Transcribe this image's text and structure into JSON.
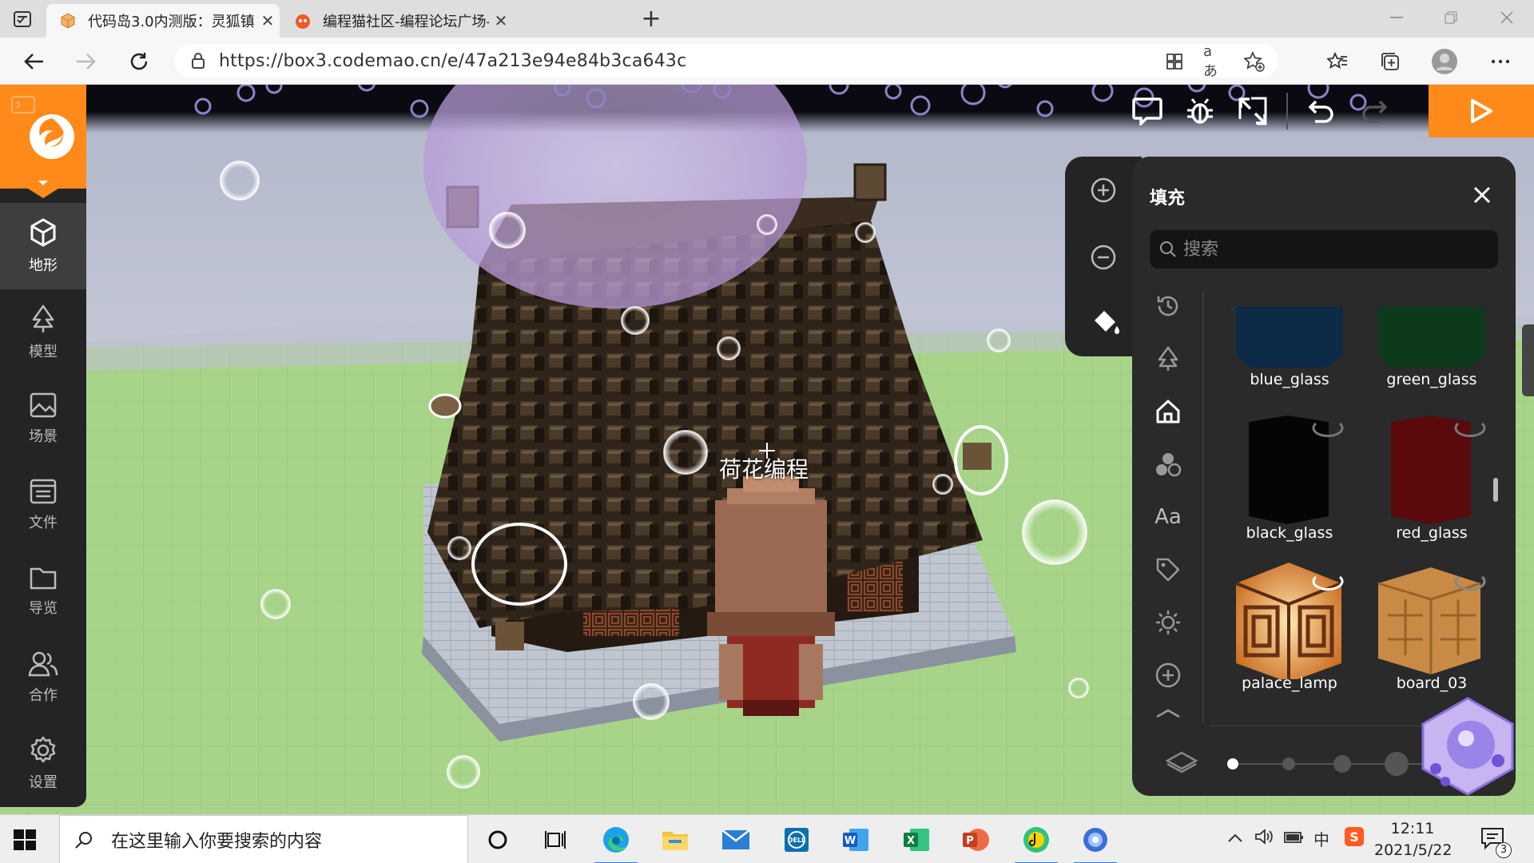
{
  "browser": {
    "tabs": [
      {
        "title": "代码岛3.0内测版：灵狐镇",
        "active": true
      },
      {
        "title": "编程猫社区-编程论坛广场-编程猫",
        "active": false
      }
    ],
    "url": "https://box3.codemao.cn/e/47a213e94e84b3ca643c"
  },
  "sidebar": {
    "items": [
      {
        "label": "地形",
        "icon": "cube-icon",
        "active": true
      },
      {
        "label": "模型",
        "icon": "tree-icon",
        "active": false
      },
      {
        "label": "场景",
        "icon": "image-icon",
        "active": false
      },
      {
        "label": "文件",
        "icon": "file-icon",
        "active": false
      },
      {
        "label": "导览",
        "icon": "folder-icon",
        "active": false
      },
      {
        "label": "合作",
        "icon": "users-icon",
        "active": false
      },
      {
        "label": "设置",
        "icon": "gear-icon",
        "active": false
      }
    ]
  },
  "scene": {
    "name_tag": "荷花编程"
  },
  "panel": {
    "title": "填充",
    "search_placeholder": "搜索",
    "categories": [
      "history-icon",
      "tree-icon",
      "house-icon",
      "shapes-icon",
      "text-icon",
      "tag-icon",
      "sun-icon",
      "plus-icon",
      "layers-icon"
    ],
    "text_category_label": "Aa",
    "tiles": [
      {
        "name": "blue_glass",
        "color": "#0d2b47"
      },
      {
        "name": "green_glass",
        "color": "#0e3a1c"
      },
      {
        "name": "black_glass",
        "color": "#050505"
      },
      {
        "name": "red_glass",
        "color": "#5a0a0d"
      },
      {
        "name": "palace_lamp",
        "color": "#e8a040"
      },
      {
        "name": "board_03",
        "color": "#c98a46"
      }
    ],
    "brush_steps": 4
  },
  "colors": {
    "accent": "#ff8a1a",
    "sidebar_bg": "#242424",
    "panel_bg": "#2a2a2a"
  },
  "taskbar": {
    "search_placeholder": "在这里输入你要搜索的内容",
    "time": "12:11",
    "date": "2021/5/22",
    "ime": "中",
    "notifications": "3"
  }
}
